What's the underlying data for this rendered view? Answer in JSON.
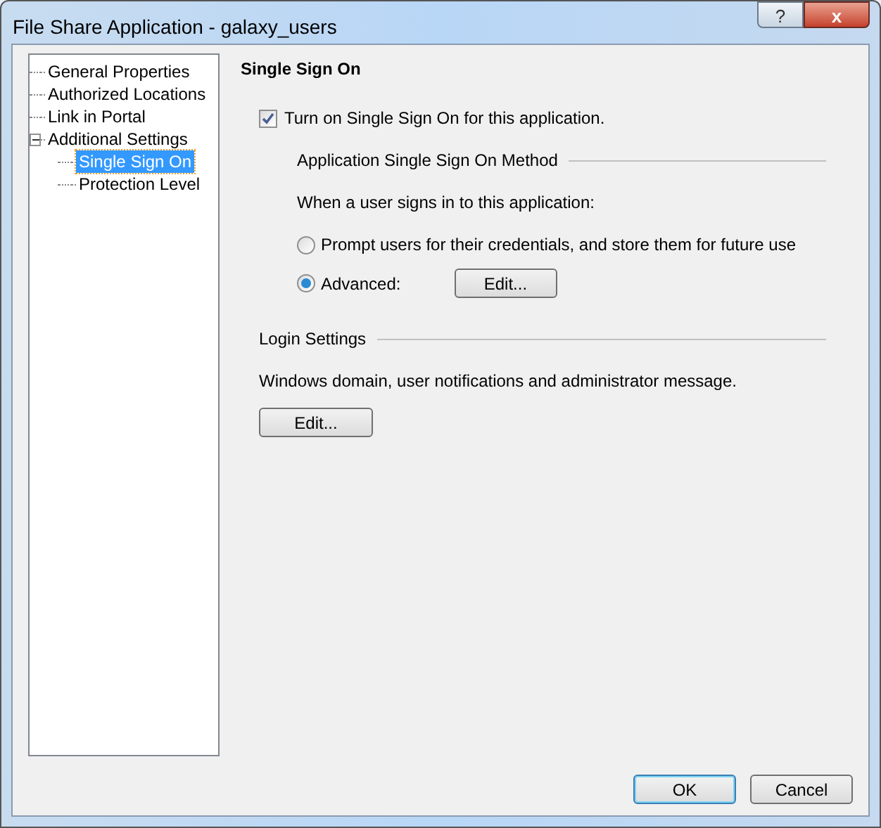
{
  "window": {
    "title": "File Share Application - galaxy_users",
    "controls": [
      {
        "kind": "help",
        "label": "?"
      },
      {
        "kind": "close",
        "label": "x"
      }
    ]
  },
  "tree": [
    {
      "label": "General Properties",
      "selected": false
    },
    {
      "label": "Authorized Locations",
      "selected": false
    },
    {
      "label": "Link in Portal",
      "selected": false
    },
    {
      "label": "Additional Settings",
      "selected": false,
      "expanded": true,
      "children": [
        {
          "label": "Single Sign On",
          "selected": true
        },
        {
          "label": "Protection Level",
          "selected": false
        }
      ]
    }
  ],
  "page": {
    "heading": "Single Sign On",
    "enable": {
      "label": "Turn on Single Sign On for this application.",
      "checked": true
    },
    "method_group": {
      "title": "Application Single Sign On Method",
      "prompt": "When a user signs in to this application:",
      "options": [
        {
          "label": "Prompt users for their credentials, and store them for future use",
          "selected": false
        },
        {
          "label": "Advanced:",
          "selected": true,
          "button": "Edit..."
        }
      ]
    },
    "login_group": {
      "title": "Login Settings",
      "description": "Windows domain, user notifications and administrator message.",
      "button": "Edit..."
    }
  },
  "buttons": [
    {
      "label": "OK",
      "default": true
    },
    {
      "label": "Cancel",
      "default": false
    }
  ]
}
